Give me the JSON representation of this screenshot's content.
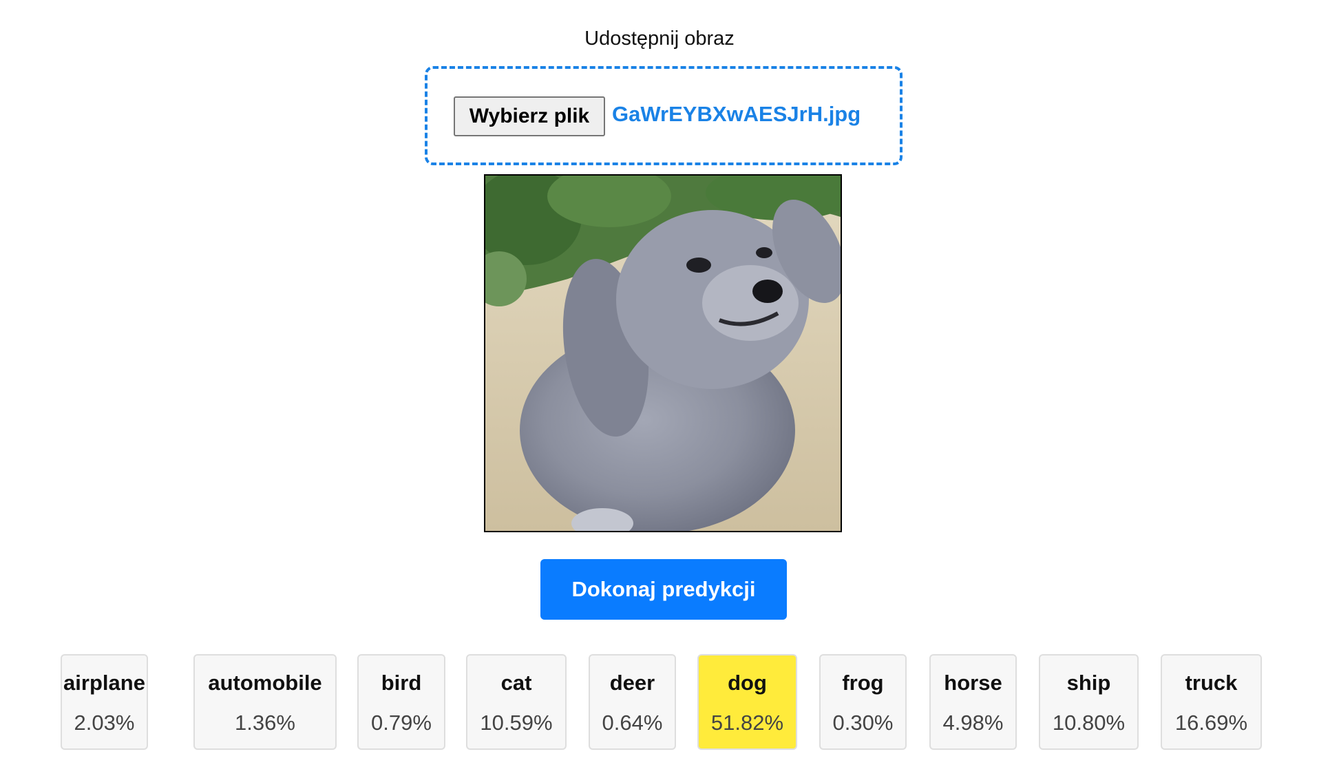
{
  "upload": {
    "heading": "Udostępnij obraz",
    "choose_file_label": "Wybierz plik",
    "file_name": "GaWrEYBXwAESJrH.jpg"
  },
  "preview": {
    "description_icon": "uploaded-image-preview"
  },
  "predict": {
    "button_label": "Dokonaj predykcji"
  },
  "colors": {
    "accent": "#0a7cff",
    "dashed_border": "#1a82e6",
    "highlight": "#ffeb3b",
    "card_background": "#f7f7f7"
  },
  "results": [
    {
      "label": "airplane",
      "value": "2.03%"
    },
    {
      "label": "automobile",
      "value": "1.36%"
    },
    {
      "label": "bird",
      "value": "0.79%"
    },
    {
      "label": "cat",
      "value": "10.59%"
    },
    {
      "label": "deer",
      "value": "0.64%"
    },
    {
      "label": "dog",
      "value": "51.82%",
      "top": true
    },
    {
      "label": "frog",
      "value": "0.30%"
    },
    {
      "label": "horse",
      "value": "4.98%"
    },
    {
      "label": "ship",
      "value": "10.80%"
    },
    {
      "label": "truck",
      "value": "16.69%"
    }
  ]
}
